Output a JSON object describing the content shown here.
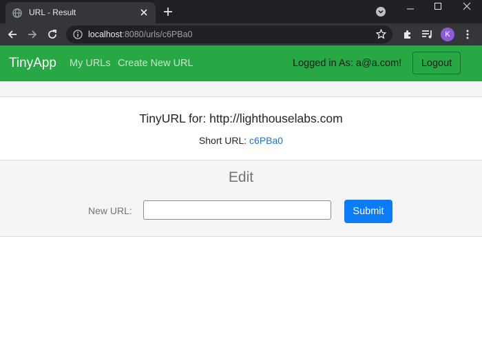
{
  "browser": {
    "tab_title": "URL - Result",
    "url_host": "localhost",
    "url_path": ":8080/urls/c6PBa0",
    "avatar_letter": "K",
    "icons": [
      "globe-icon",
      "close-icon",
      "plus-icon",
      "tab-search-icon",
      "minimize-icon",
      "maximize-icon",
      "close-window-icon",
      "back-icon",
      "forward-icon",
      "reload-icon",
      "info-icon",
      "star-icon",
      "extensions-icon",
      "media-icon",
      "menu-icon"
    ]
  },
  "navbar": {
    "brand": "TinyApp",
    "links": [
      {
        "label": "My URLs"
      },
      {
        "label": "Create New URL"
      }
    ],
    "logged_in": "Logged in As: a@a.com!",
    "logout_label": "Logout",
    "bg_color": "#28a745"
  },
  "card": {
    "title": "TinyURL for: http://lighthouselabs.com",
    "short_url_label": "Short URL: ",
    "short_url_value": "c6PBa0"
  },
  "edit": {
    "title": "Edit",
    "new_url_label": "New URL:",
    "input_value": "",
    "submit_label": "Submit",
    "submit_color": "#0b7cf5"
  }
}
